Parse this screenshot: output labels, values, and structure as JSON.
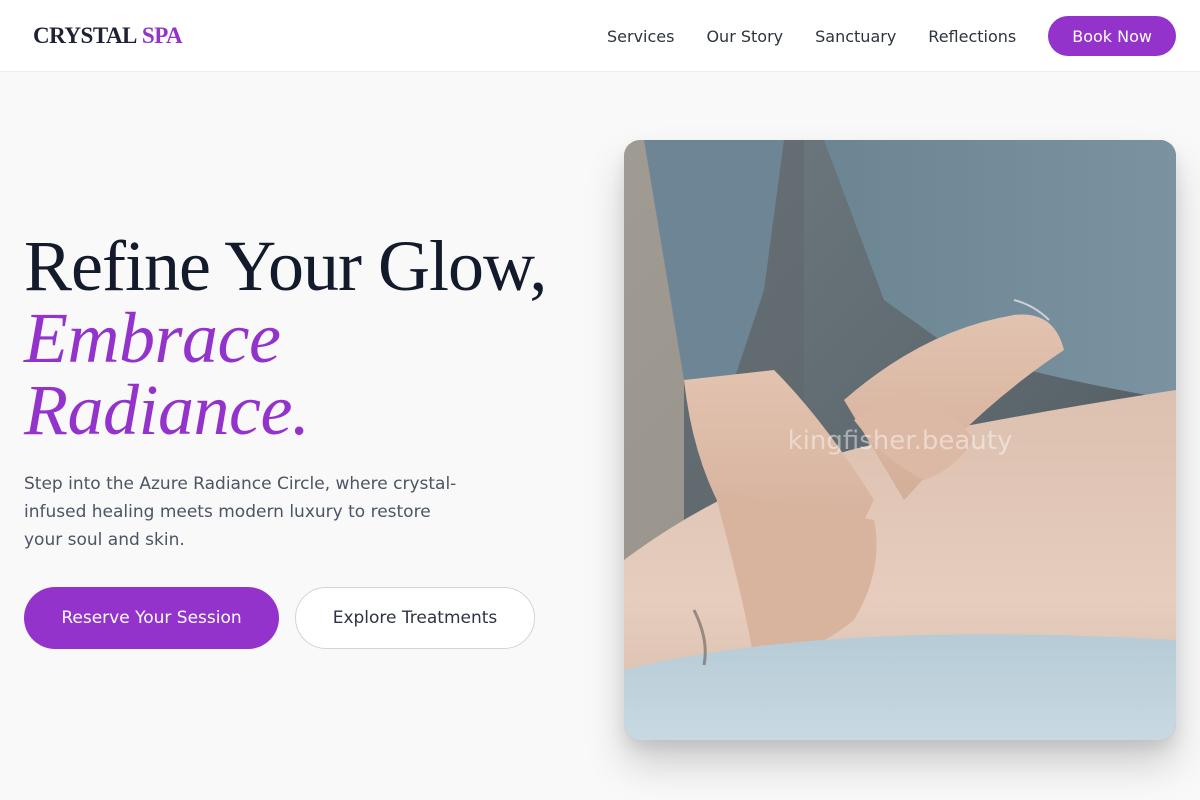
{
  "header": {
    "logo_main": "CRYSTAL",
    "logo_accent": "SPA",
    "nav": [
      {
        "label": "Services"
      },
      {
        "label": "Our Story"
      },
      {
        "label": "Sanctuary"
      },
      {
        "label": "Reflections"
      }
    ],
    "book_label": "Book Now"
  },
  "hero": {
    "title_line1": "Refine Your Glow,",
    "title_line2": "Embrace",
    "title_line3": "Radiance.",
    "description": "Step into the Azure Radiance Circle, where crystal-infused healing meets modern luxury to restore your soul and skin.",
    "primary_cta": "Reserve Your Session",
    "secondary_cta": "Explore Treatments",
    "image_watermark": "kingfisher.beauty"
  },
  "colors": {
    "accent": "#9333cc",
    "heading": "#131a2b",
    "body_text": "#4b5563",
    "background": "#f9f9f9"
  }
}
